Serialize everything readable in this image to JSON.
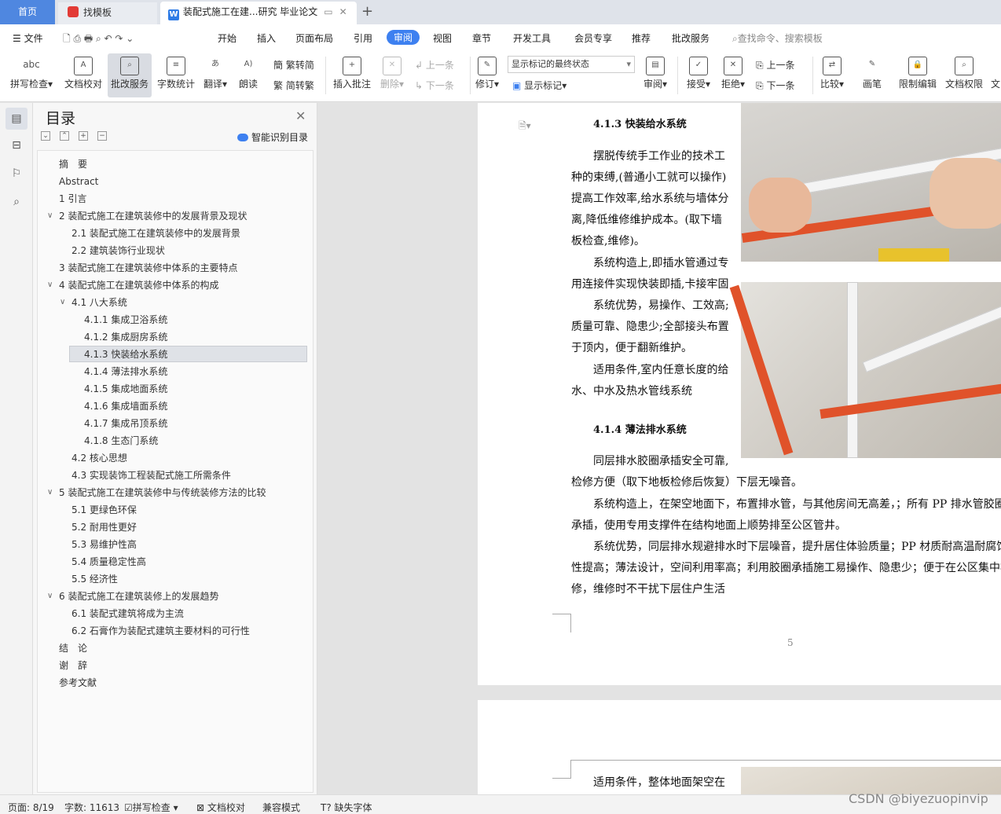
{
  "tabs": {
    "home": "首页",
    "template": "找模板",
    "doc": "装配式施工在建...研究 毕业论文"
  },
  "menu": {
    "file": "文件",
    "items": [
      "开始",
      "插入",
      "页面布局",
      "引用",
      "审阅",
      "视图",
      "章节",
      "开发工具",
      "会员专享",
      "推荐",
      "批改服务"
    ],
    "search": "查找命令、搜索模板"
  },
  "ribbon": {
    "spell": "拼写检查",
    "proof": "文档校对",
    "review_service": "批改服务",
    "wordcount": "字数统计",
    "translate": "翻译",
    "read": "朗读",
    "trad": "繁转简",
    "simp": "简转繁",
    "insert_comment": "插入批注",
    "delete": "删除",
    "prev": "上一条",
    "next": "下一条",
    "revise": "修订",
    "display_state": "显示标记的最终状态",
    "show_marks": "显示标记",
    "review": "审阅",
    "accept": "接受",
    "reject": "拒绝",
    "prev2": "上一条",
    "next2": "下一条",
    "compare": "比较",
    "pen": "画笔",
    "restrict": "限制编辑",
    "rights": "文档权限",
    "cut": "文"
  },
  "toc": {
    "title": "目录",
    "smart": "智能识别目录",
    "items": [
      "摘　要",
      "Abstract",
      "1 引言",
      "2 装配式施工在建筑装修中的发展背景及现状",
      "2.1 装配式施工在建筑装修中的发展背景",
      "2.2 建筑装饰行业现状",
      "3 装配式施工在建筑装修中体系的主要特点",
      "4 装配式施工在建筑装修中体系的构成",
      "4.1 八大系统",
      "4.1.1 集成卫浴系统",
      "4.1.2 集成厨房系统",
      "4.1.3 快装给水系统",
      "4.1.4 薄法排水系统",
      "4.1.5 集成地面系统",
      "4.1.6 集成墙面系统",
      "4.1.7 集成吊顶系统",
      "4.1.8 生态门系统",
      "4.2 核心思想",
      "4.3 实现装饰工程装配式施工所需条件",
      "5 装配式施工在建筑装修中与传统装修方法的比较",
      "5.1 更绿色环保",
      "5.2 耐用性更好",
      "5.3 易维护性高",
      "5.4 质量稳定性高",
      "5.5 经济性",
      "6 装配式施工在建筑装修上的发展趋势",
      "6.1 装配式建筑将成为主流",
      "6.2 石膏作为装配式建筑主要材料的可行性",
      "结　论",
      "谢　辞",
      "参考文献"
    ]
  },
  "doc": {
    "h413": "4.1.3 快装给水系统",
    "p1": [
      "摆脱传统手工作业的技术工",
      "种的束缚,(普通小工就可以操作)",
      "提高工作效率,给水系统与墙体分",
      "离,降低维修维护成本。(取下墙",
      "板检查,维修)。"
    ],
    "p2": [
      "系统构造上,即插水管通过专",
      "用连接件实现快装即插,卡接牢固"
    ],
    "p3": [
      "系统优势，易操作、工效高;",
      "质量可靠、隐患少;全部接头布置",
      "于顶内，便于翻新维护。"
    ],
    "p4": [
      "适用条件,室内任意长度的给",
      "水、中水及热水管线系统"
    ],
    "h414": "4.1.4 薄法排水系统",
    "p5": [
      "同层排水胶圈承插安全可靠,",
      "检修方便（取下地板检修后恢复）下层无噪音。"
    ],
    "p6": [
      "系统构造上，在架空地面下，布置排水管，与其他房间无高差，；所有 PP 排水管胶圈",
      "承插，使用专用支撑件在结构地面上顺势排至公区管井。"
    ],
    "p7": [
      "系统优势，同层排水规避排水时下层噪音，提升居住体验质量；PP 材质耐高温耐腐蚀",
      "性提高；薄法设计，空间利用率高；利用胶圈承插施工易操作、隐患少；便于在公区集中检",
      "修，维修时不干扰下层住户生活"
    ],
    "pagenum": "5",
    "p8": "适用条件，整体地面架空在"
  },
  "status": {
    "page": "页面: 8/19",
    "words": "字数: 11613",
    "spell": "拼写检查",
    "proof": "文档校对",
    "compat": "兼容模式",
    "font": "缺失字体"
  },
  "watermark": "CSDN @biyezuopinvip"
}
